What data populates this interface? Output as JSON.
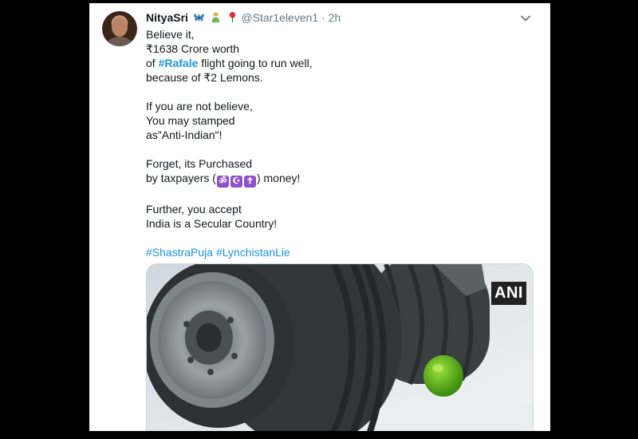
{
  "tweet": {
    "display_name": "NityaSri",
    "handle": "@Star1eleven1",
    "separator": "·",
    "time": "2h",
    "lines": {
      "p1_l1": "Believe it,",
      "p1_l2": "₹1638 Crore worth",
      "p1_l3_pre": "of ",
      "p1_l3_tag": "#Rafale",
      "p1_l3_post": " flight going to run well,",
      "p1_l4": "because of ₹2 Lemons.",
      "p2_l1": "If you are not believe,",
      "p2_l2": "You may stamped",
      "p2_l3": "as\"Anti-Indian\"!",
      "p3_l1": "Forget, its Purchased",
      "p3_l2_pre": "by taxpayers (",
      "p3_l2_post": ") money!",
      "p4_l1": "Further, you accept",
      "p4_l2": "India is a Secular Country!"
    },
    "symbols": [
      "ॐ",
      "☪",
      "✝"
    ],
    "hashtags": [
      "#ShastraPuja",
      "#LynchistanLie"
    ],
    "media_watermark": "ANI"
  },
  "colors": {
    "link": "#1b95e0",
    "background": "#000000",
    "card": "#ffffff"
  },
  "icons": {
    "caret": "chevron-down-icon",
    "emojis": [
      "butterfly-icon",
      "person-emoji-icon",
      "rose-icon"
    ]
  }
}
